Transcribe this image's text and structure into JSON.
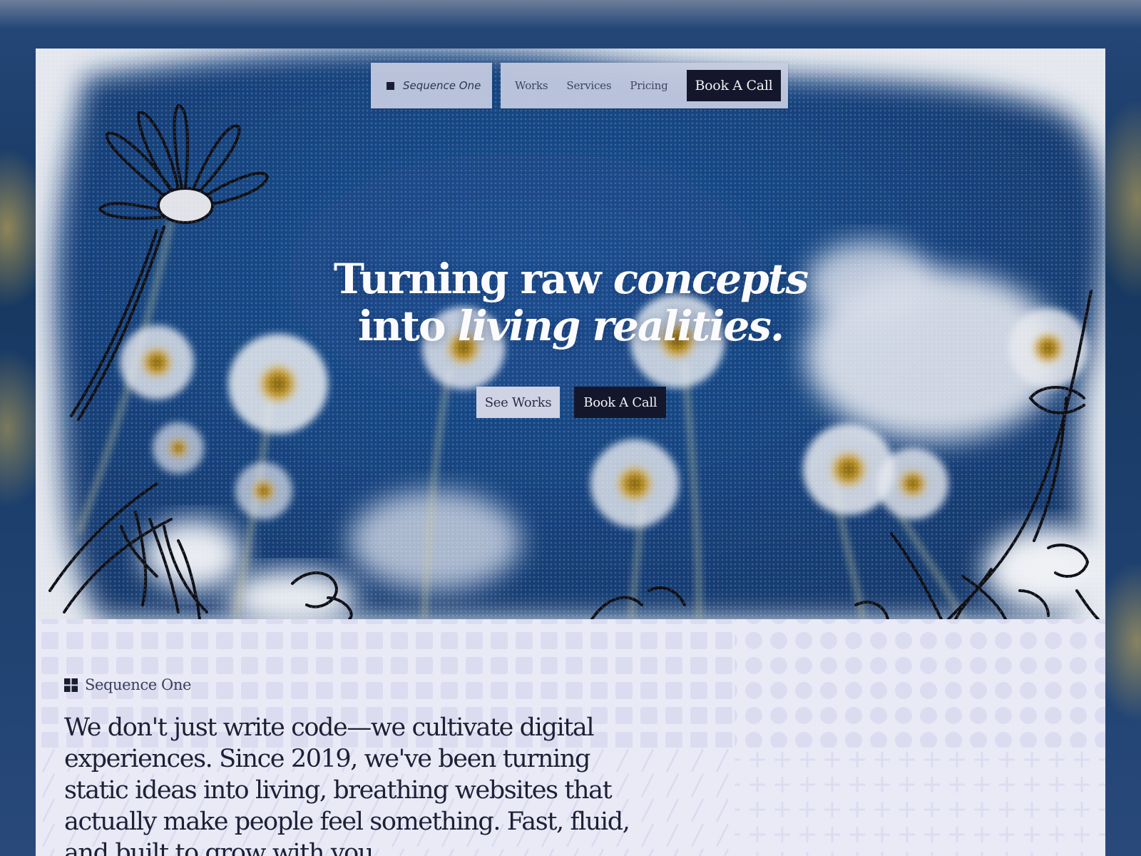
{
  "nav": {
    "brand": "Sequence One",
    "links": [
      "Works",
      "Services",
      "Pricing"
    ],
    "cta": "Book A Call"
  },
  "hero": {
    "title_line1_plain": "Turning raw ",
    "title_line1_em": "concepts",
    "title_line2_plain": "into ",
    "title_line2_em": "living realities.",
    "primary_button": "See Works",
    "secondary_button": "Book A Call"
  },
  "about": {
    "brand": "Sequence One",
    "text": "We don't just write code—we cultivate digital experiences. Since 2019, we've been turning static ideas into living, breathing websites that actually make people feel something. Fast, fluid, and built to grow with you."
  },
  "colors": {
    "dark": "#14172b",
    "sky": "#1c4a88",
    "panel": "#c7cde2",
    "about_bg": "#e9eaf6"
  }
}
